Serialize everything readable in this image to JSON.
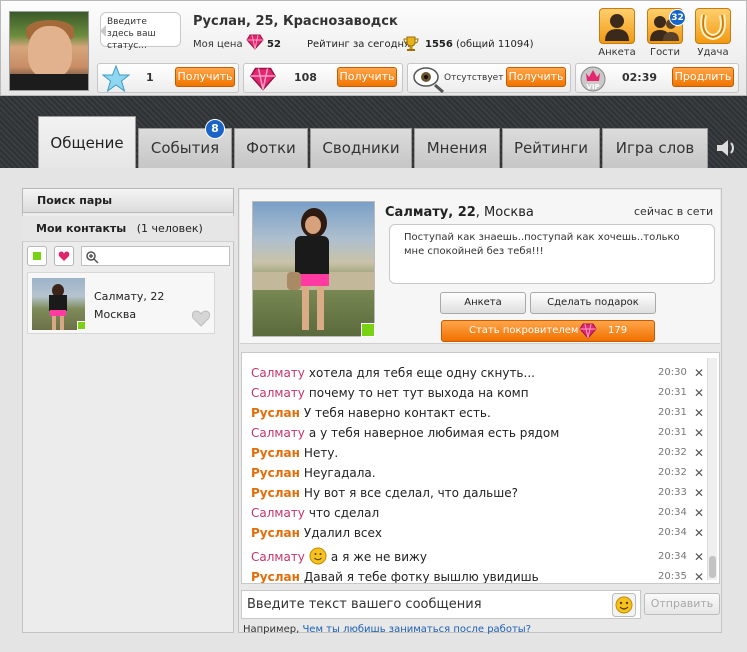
{
  "header": {
    "status_placeholder": "Введите здесь ваш статус...",
    "user_name": "Руслан, 25, Краснозаводск",
    "price_label": "Моя цена",
    "price_value": "52",
    "rating_label": "Рейтинг за сегодня",
    "rating_value": "1556",
    "rating_total": "(общий 11094)",
    "strips": {
      "stars_value": "1",
      "stars_button": "Получить",
      "gems_value": "108",
      "gems_button": "Получить",
      "invisible_label": "Отсутствует",
      "invisible_button": "Получить",
      "vip_time": "02:39",
      "vip_button": "Продлить"
    },
    "icons": [
      {
        "label": "Анкета"
      },
      {
        "label": "Гости",
        "badge": "32"
      },
      {
        "label": "Удача"
      }
    ]
  },
  "tabs": [
    {
      "label": "Общение",
      "active": true
    },
    {
      "label": "События",
      "badge": "8"
    },
    {
      "label": "Фотки"
    },
    {
      "label": "Сводники"
    },
    {
      "label": "Мнения"
    },
    {
      "label": "Рейтинги"
    },
    {
      "label": "Игра слов"
    }
  ],
  "left": {
    "search_pair": "Поиск пары",
    "contacts_title": "Мои контакты",
    "contacts_count": "(1 человек)",
    "contact": {
      "name": "Салмату, 22",
      "city": "Москва"
    }
  },
  "profile": {
    "name": "Салмату, 22",
    "city": ", Москва",
    "online": "сейчас в сети",
    "status": "Поступай как знаешь..поступай как хочешь..только мне спокойней без тебя!!!",
    "anketa_button": "Анкета",
    "gift_button": "Сделать подарок",
    "patron_button": "Стать покровителем",
    "patron_value": "179"
  },
  "chat": {
    "messages": [
      {
        "sender": "Салмату",
        "from": "her",
        "text": "хотела для тебя еще одну скнуть...",
        "time": "20:30"
      },
      {
        "sender": "Салмату",
        "from": "her",
        "text": "почему то нет тут выхода на комп",
        "time": "20:31"
      },
      {
        "sender": "Руслан",
        "from": "me",
        "text": "У тебя наверно контакт есть.",
        "time": "20:31"
      },
      {
        "sender": "Салмату",
        "from": "her",
        "text": "а у тебя наверное любимая есть рядом",
        "time": "20:31"
      },
      {
        "sender": "Руслан",
        "from": "me",
        "text": "Нету.",
        "time": "20:32"
      },
      {
        "sender": "Руслан",
        "from": "me",
        "text": "Неугадала.",
        "time": "20:32"
      },
      {
        "sender": "Руслан",
        "from": "me",
        "text": "Ну вот я все сделал, что дальше?",
        "time": "20:33"
      },
      {
        "sender": "Салмату",
        "from": "her",
        "text": "что сделал",
        "time": "20:34"
      },
      {
        "sender": "Руслан",
        "from": "me",
        "text": "Удалил всех",
        "time": "20:34"
      },
      {
        "sender": "Салмату",
        "from": "her",
        "text": "а я же не вижу",
        "time": "20:34",
        "emoji": true
      },
      {
        "sender": "Руслан",
        "from": "me",
        "text": "Давай я тебе фотку вышлю увидишь",
        "time": "20:35"
      }
    ],
    "input_placeholder": "Введите текст вашего сообщения",
    "send_button": "Отправить",
    "hint_prefix": "Например, ",
    "hint_link": "Чем ты любишь заниматься после работы?"
  },
  "colors": {
    "accent": "#f07400",
    "her": "#c4346b",
    "me": "#e46d0a",
    "badge": "#1566c9"
  }
}
